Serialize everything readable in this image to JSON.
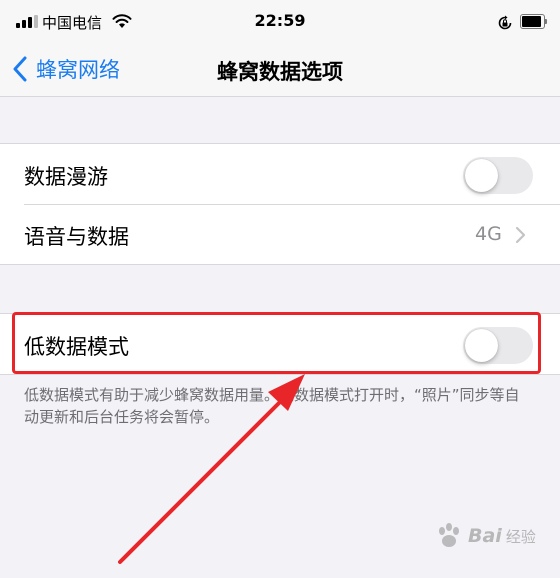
{
  "status_bar": {
    "carrier": "中国电信",
    "time": "22:59"
  },
  "nav": {
    "back_label": "蜂窝网络",
    "title": "蜂窝数据选项"
  },
  "settings_group_1": {
    "rows": [
      {
        "label": "数据漫游",
        "control": "toggle",
        "on": false
      },
      {
        "label": "语音与数据",
        "control": "disclosure",
        "value": "4G"
      }
    ]
  },
  "settings_group_2": {
    "rows": [
      {
        "label": "低数据模式",
        "control": "toggle",
        "on": false
      }
    ],
    "footer": "低数据模式有助于减少蜂窝数据用量。低数据模式打开时，“照片”同步等自动更新和后台任务将会暂停。"
  },
  "annotation": {
    "highlight_color": "#e8262a",
    "arrow_color": "#e8262a"
  },
  "watermark": {
    "text": "Bai",
    "sub": "经验"
  },
  "colors": {
    "accent": "#1a7cf0",
    "toggle_off": "#e9e9eb",
    "secondary_text": "#8e8e93",
    "background": "#f2f2f7"
  },
  "icons": {
    "signal": "cellular-signal-icon",
    "wifi": "wifi-icon",
    "orientation_lock": "orientation-lock-icon",
    "battery": "battery-icon",
    "back": "chevron-left-icon",
    "disclosure": "chevron-right-icon",
    "watermark_logo": "baidu-paw-icon"
  }
}
